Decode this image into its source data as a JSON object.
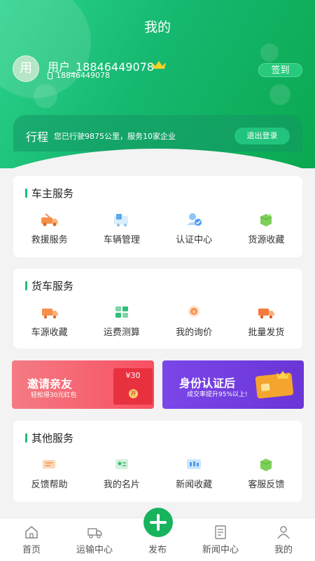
{
  "header": {
    "title": "我的",
    "avatar_text": "用",
    "username": "用户_18846449078",
    "phone": "18846449078",
    "signin_label": "签到",
    "crown_icon": "crown-icon",
    "phone_icon": "phone-icon"
  },
  "trip": {
    "title": "行程",
    "desc": "您已行驶9875公里，服务10家企业",
    "logout_label": "退出登录"
  },
  "owner_services": {
    "title": "车主服务",
    "items": [
      {
        "label": "救援服务",
        "icon": "rescue-truck-icon"
      },
      {
        "label": "车辆管理",
        "icon": "vehicle-management-icon"
      },
      {
        "label": "认证中心",
        "icon": "verification-icon"
      },
      {
        "label": "货源收藏",
        "icon": "cargo-favorite-icon"
      }
    ]
  },
  "truck_services": {
    "title": "货车服务",
    "items": [
      {
        "label": "车源收藏",
        "icon": "truck-favorite-icon"
      },
      {
        "label": "运费测算",
        "icon": "freight-calculator-icon"
      },
      {
        "label": "我的询价",
        "icon": "inquiry-icon"
      },
      {
        "label": "批量发货",
        "icon": "batch-shipping-icon"
      }
    ]
  },
  "banners": {
    "invite_title": "邀请亲友",
    "invite_sub": "轻松得30元红包",
    "invite_amount": "¥30",
    "invite_open": "开",
    "verify_title": "身份认证后",
    "verify_sub": "成交率提升95%以上!"
  },
  "other_services": {
    "title": "其他服务",
    "items": [
      {
        "label": "反馈帮助",
        "icon": "feedback-icon"
      },
      {
        "label": "我的名片",
        "icon": "business-card-icon"
      },
      {
        "label": "新闻收藏",
        "icon": "news-favorite-icon"
      },
      {
        "label": "客服反馈",
        "icon": "customer-service-icon"
      }
    ]
  },
  "bottom_nav": {
    "items": [
      {
        "label": "首页",
        "icon": "home-icon"
      },
      {
        "label": "运输中心",
        "icon": "truck-icon"
      },
      {
        "label": "发布",
        "icon": "plus-icon"
      },
      {
        "label": "新闻中心",
        "icon": "news-icon"
      },
      {
        "label": "我的",
        "icon": "user-icon"
      }
    ]
  },
  "colors": {
    "brand_green": "#1cbf75",
    "accent_orange": "#f7904a",
    "invite_red": "#f85062",
    "verify_purple": "#7b46e8"
  }
}
